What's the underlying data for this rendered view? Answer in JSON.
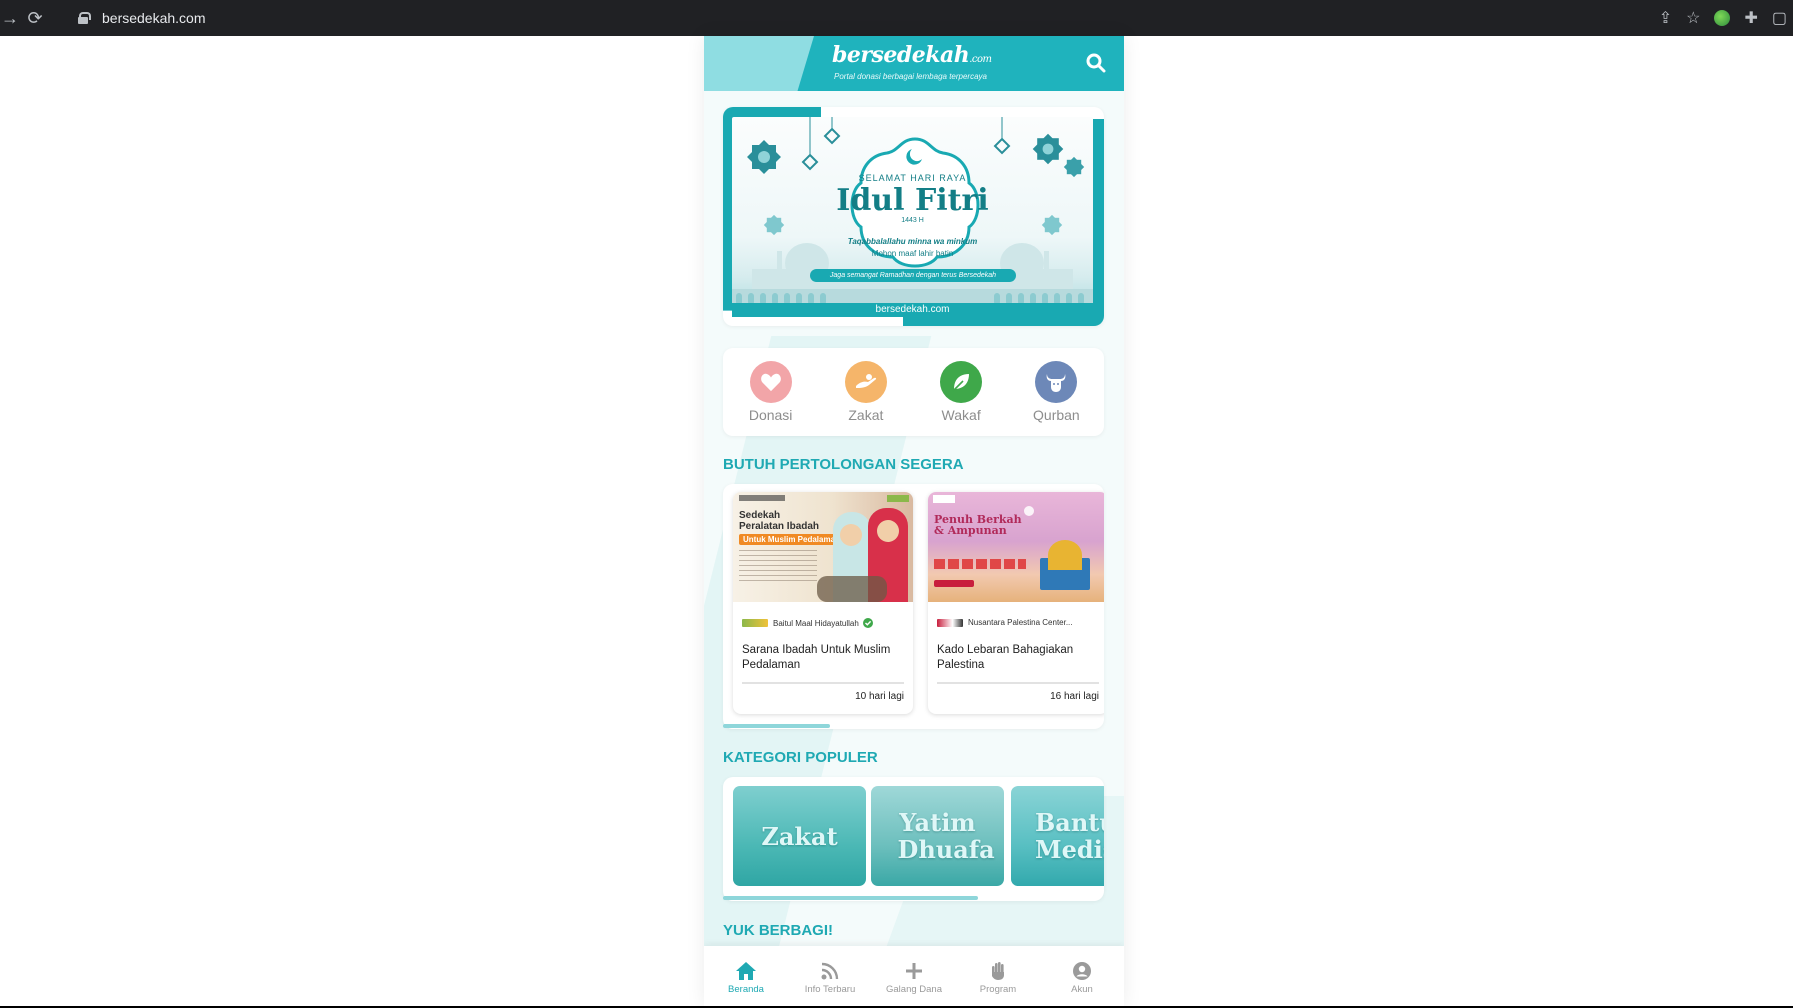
{
  "browser": {
    "url": "bersedekah.com"
  },
  "header": {
    "logo_main": "bersedekah",
    "logo_suffix": ".com",
    "tagline": "Portal donasi berbagai lembaga terpercaya"
  },
  "banner": {
    "small_title": "SELAMAT HARI RAYA",
    "title": "Idul Fitri",
    "year": "1443 H",
    "greeting": "Taqabbalallahu minna wa minkum",
    "sub": "Mohon maaf lahir batin",
    "pill": "Jaga semangat Ramadhan dengan terus Bersedekah",
    "footer": "bersedekah.com"
  },
  "categories": [
    {
      "label": "Donasi",
      "color": "#f2a5a8",
      "icon": "heart-icon"
    },
    {
      "label": "Zakat",
      "color": "#f5b56a",
      "icon": "hand-icon"
    },
    {
      "label": "Wakaf",
      "color": "#3fa84a",
      "icon": "leaf-icon"
    },
    {
      "label": "Qurban",
      "color": "#6d88b8",
      "icon": "cow-icon"
    }
  ],
  "urgent": {
    "title": "BUTUH PERTOLONGAN SEGERA",
    "cards": [
      {
        "thumb_title_1": "Sedekah",
        "thumb_title_2": "Peralatan Ibadah",
        "thumb_tag": "Untuk Muslim Pedalaman",
        "org": "Baitul Maal Hidayatullah",
        "verified": true,
        "title": "Sarana Ibadah Untuk Muslim Pedalaman",
        "days": "10 hari lagi"
      },
      {
        "thumb_title_1": "Penuh Berkah",
        "thumb_title_2": "& Ampunan",
        "org": "Nusantara Palestina Center...",
        "verified": false,
        "title": "Kado Lebaran Bahagiakan Palestina",
        "days": "16 hari lagi"
      }
    ],
    "scroll_progress": 0.28
  },
  "popular": {
    "title": "KATEGORI POPULER",
    "tiles": [
      "Zakat",
      "Yatim Dhuafa",
      "Bantuan Medis"
    ],
    "scroll_progress": 0.67
  },
  "share": {
    "title": "YUK BERBAGI!"
  },
  "bottom_nav": [
    {
      "label": "Beranda",
      "icon": "home-icon",
      "active": true
    },
    {
      "label": "Info Terbaru",
      "icon": "rss-icon",
      "active": false
    },
    {
      "label": "Galang Dana",
      "icon": "plus-icon",
      "active": false
    },
    {
      "label": "Program",
      "icon": "hand-raised-icon",
      "active": false
    },
    {
      "label": "Akun",
      "icon": "account-icon",
      "active": false
    }
  ],
  "colors": {
    "primary": "#1fb3bd",
    "accent_text": "#1fa9b3"
  }
}
